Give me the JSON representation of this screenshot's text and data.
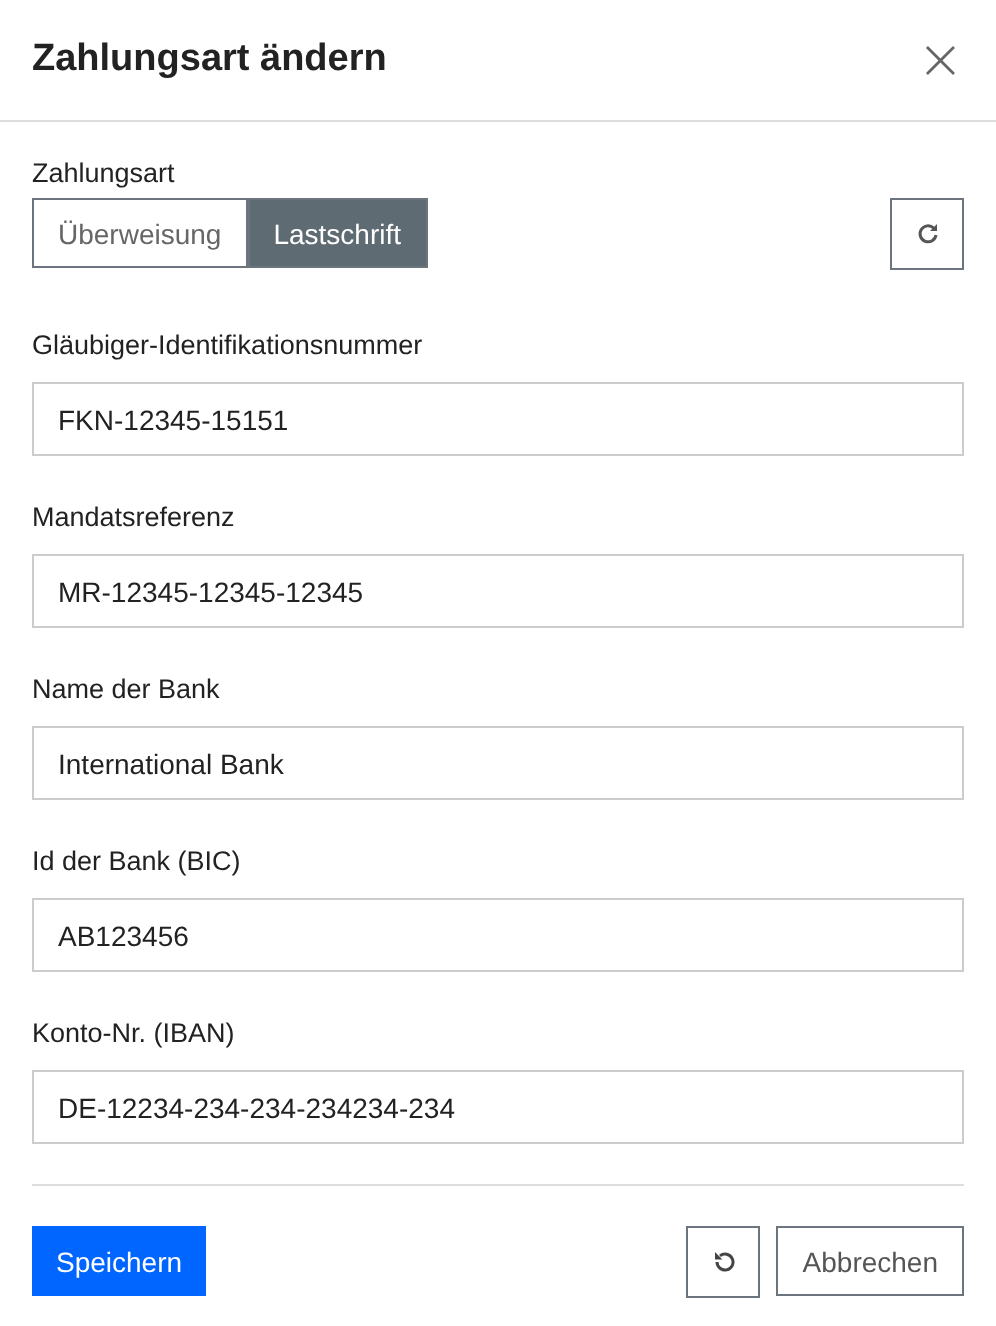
{
  "dialog": {
    "title": "Zahlungsart ändern",
    "close_icon": "×"
  },
  "payment_type": {
    "label": "Zahlungsart",
    "options": [
      {
        "label": "Überweisung",
        "selected": false
      },
      {
        "label": "Lastschrift",
        "selected": true
      }
    ]
  },
  "fields": [
    {
      "label": "Gläubiger-Identifikationsnummer",
      "value": "FKN-12345-15151"
    },
    {
      "label": "Mandatsreferenz",
      "value": "MR-12345-12345-12345"
    },
    {
      "label": "Name der Bank",
      "value": "International Bank"
    },
    {
      "label": "Id der Bank (BIC)",
      "value": "AB123456"
    },
    {
      "label": "Konto-Nr. (IBAN)",
      "value": "DE-12234-234-234-234234-234"
    }
  ],
  "footer": {
    "save": "Speichern",
    "cancel": "Abbrechen"
  }
}
